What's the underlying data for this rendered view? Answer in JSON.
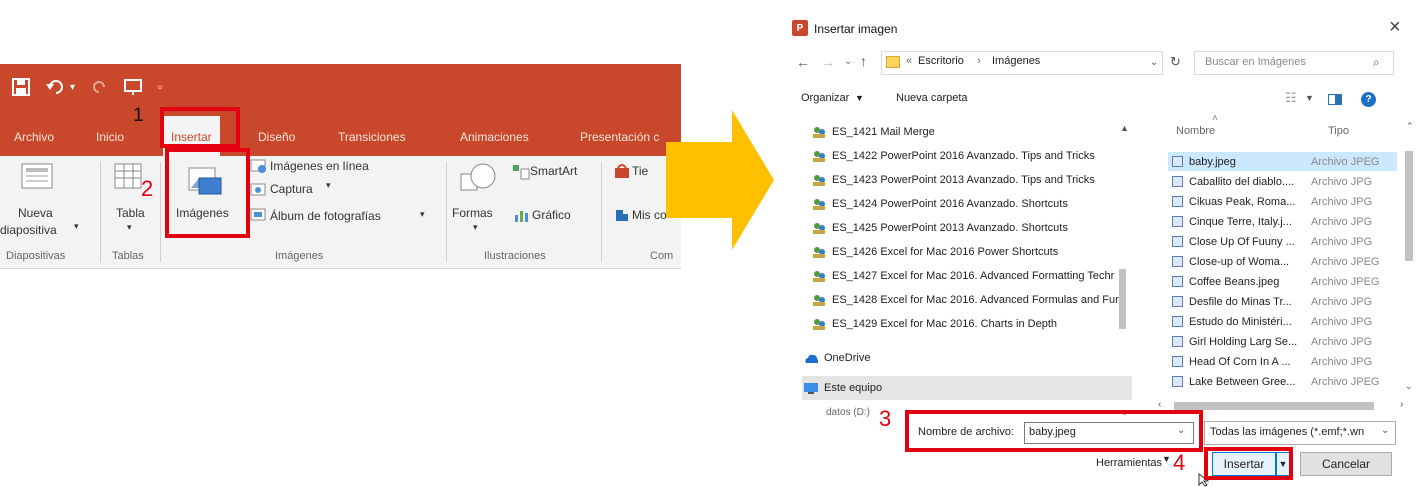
{
  "ribbon": {
    "tabs": [
      "Archivo",
      "Inicio",
      "Insertar",
      "Diseño",
      "Transiciones",
      "Animaciones",
      "Presentación c"
    ],
    "active_tab": "Insertar",
    "groups": {
      "diapositivas": {
        "button": "Nueva",
        "button_line2": "diapositiva",
        "label": "Diapositivas"
      },
      "tablas": {
        "button": "Tabla",
        "label": "Tablas"
      },
      "imagenes": {
        "button": "Imágenes",
        "online": "Imágenes en línea",
        "capture": "Captura",
        "album": "Álbum de fotografías",
        "label": "Imágenes"
      },
      "ilustraciones": {
        "formas": "Formas",
        "smartart": "SmartArt",
        "grafico": "Gráfico",
        "label": "Ilustraciones"
      },
      "complementos": {
        "tienda": "Tie",
        "mis": "Mis co",
        "label": "Com"
      }
    }
  },
  "steps": {
    "s1": "1",
    "s2": "2",
    "s3": "3",
    "s4": "4"
  },
  "dialog": {
    "title": "Insertar imagen",
    "close": "×",
    "breadcrumb": {
      "prefix": "«",
      "part1": "Escritorio",
      "sep": "›",
      "part2": "Imágenes"
    },
    "search_placeholder": "Buscar en Imágenes",
    "organize": "Organizar",
    "new_folder": "Nueva carpeta",
    "nav_items": [
      "ES_1421 Mail Merge",
      "ES_1422 PowerPoint 2016 Avanzado. Tips and Tricks",
      "ES_1423 PowerPoint 2013 Avanzado. Tips and Tricks",
      "ES_1424 PowerPoint 2016 Avanzado. Shortcuts",
      "ES_1425 PowerPoint 2013 Avanzado. Shortcuts",
      "ES_1426 Excel for Mac 2016 Power Shortcuts",
      "ES_1427 Excel for Mac 2016. Advanced Formatting Techr",
      "ES_1428 Excel for Mac 2016. Advanced Formulas and Fur",
      "ES_1429 Excel for Mac 2016. Charts in Depth"
    ],
    "onedrive": "OneDrive",
    "este_equipo": "Este equipo",
    "cut_item": "datos (D:)",
    "col_name": "Nombre",
    "col_type": "Tipo",
    "files": [
      {
        "name": "baby.jpeg",
        "type": "Archivo JPEG"
      },
      {
        "name": "Caballito del diablo....",
        "type": "Archivo JPG"
      },
      {
        "name": "Cikuas Peak, Roma...",
        "type": "Archivo JPG"
      },
      {
        "name": "Cinque Terre, Italy.j...",
        "type": "Archivo JPG"
      },
      {
        "name": "Close Up Of Fuuny ...",
        "type": "Archivo JPG"
      },
      {
        "name": "Close-up of Woma...",
        "type": "Archivo JPEG"
      },
      {
        "name": "Coffee Beans.jpeg",
        "type": "Archivo JPEG"
      },
      {
        "name": "Desfile do Minas Tr...",
        "type": "Archivo JPG"
      },
      {
        "name": "Estudo do Ministéri...",
        "type": "Archivo JPG"
      },
      {
        "name": "Girl Holding Larg Se...",
        "type": "Archivo JPG"
      },
      {
        "name": "Head Of Corn In A ...",
        "type": "Archivo JPG"
      },
      {
        "name": "Lake Between Gree...",
        "type": "Archivo JPEG"
      }
    ],
    "filename_label": "Nombre de archivo:",
    "filename_value": "baby.jpeg",
    "filter": "Todas las imágenes (*.emf;*.wn",
    "tools": "Herramientas",
    "insert": "Insertar",
    "cancel": "Cancelar"
  },
  "colors": {
    "ribbon": "#c9472a",
    "arrow": "#ffc000",
    "highlight": "#e3000f",
    "selected": "#cce8ff"
  }
}
